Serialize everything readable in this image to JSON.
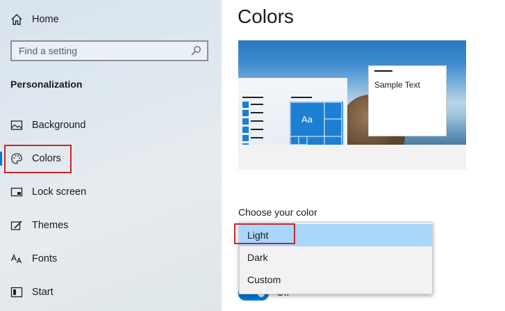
{
  "sidebar": {
    "home_label": "Home",
    "search_placeholder": "Find a setting",
    "section_title": "Personalization",
    "items": [
      {
        "label": "Background",
        "icon": "image-icon"
      },
      {
        "label": "Colors",
        "icon": "palette-icon"
      },
      {
        "label": "Lock screen",
        "icon": "lock-screen-icon"
      },
      {
        "label": "Themes",
        "icon": "themes-icon"
      },
      {
        "label": "Fonts",
        "icon": "fonts-icon"
      },
      {
        "label": "Start",
        "icon": "start-icon"
      }
    ]
  },
  "main": {
    "title": "Colors",
    "preview": {
      "tile_text": "Aa",
      "sample_text": "Sample Text"
    },
    "choose_label": "Choose your color",
    "dropdown": {
      "options": [
        "Light",
        "Dark",
        "Custom"
      ],
      "selected": "Light"
    },
    "toggle_state": "Off"
  },
  "colors": {
    "accent": "#0078d7",
    "highlight_border": "#c9252f",
    "selected_option": "#a9d6fb"
  }
}
